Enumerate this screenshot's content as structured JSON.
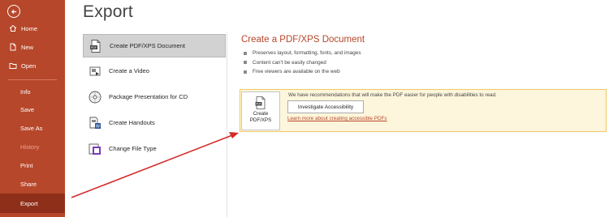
{
  "sidebar": {
    "back_icon": "back-arrow-icon",
    "items": [
      {
        "label": "Home",
        "icon": "home-icon"
      },
      {
        "label": "New",
        "icon": "new-document-icon"
      },
      {
        "label": "Open",
        "icon": "folder-icon"
      },
      {
        "label": "Info"
      },
      {
        "label": "Save"
      },
      {
        "label": "Save As"
      },
      {
        "label": "History",
        "state": "disabled"
      },
      {
        "label": "Print"
      },
      {
        "label": "Share"
      },
      {
        "label": "Export",
        "state": "selected"
      }
    ]
  },
  "page_title": "Export",
  "export_options": [
    {
      "label": "Create PDF/XPS Document",
      "icon": "pdf-document-icon",
      "state": "selected"
    },
    {
      "label": "Create a Video",
      "icon": "video-icon"
    },
    {
      "label": "Package Presentation for CD",
      "icon": "cd-icon"
    },
    {
      "label": "Create Handouts",
      "icon": "handouts-icon"
    },
    {
      "label": "Change File Type",
      "icon": "file-type-icon"
    }
  ],
  "detail": {
    "title": "Create a PDF/XPS Document",
    "bullets": [
      "Preserves layout, formatting, fonts, and images",
      "Content can't be easily changed",
      "Free viewers are available on the web"
    ],
    "pdf_button_line1": "Create",
    "pdf_button_line2": "PDF/XPS",
    "recommendation": "We have recommendations that will make the PDF easier for people with disabilities to read.",
    "accessibility_button": "Investigate Accessibility",
    "learn_link": "Learn more about creating accessible PDFs"
  },
  "colors": {
    "sidebar": "#b7472a",
    "sidebar_selected": "#8e2f19",
    "accent_text": "#b7472a",
    "callout_bg": "#fdf6dc",
    "callout_border": "#f0cb60",
    "annotation_arrow": "#d42a2a"
  }
}
